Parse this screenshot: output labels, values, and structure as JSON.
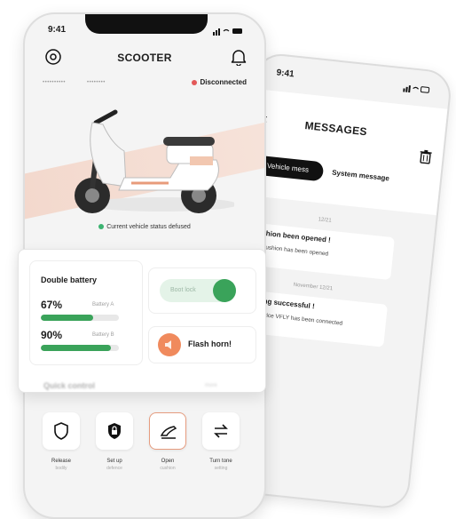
{
  "messages_phone": {
    "time": "9:41",
    "title": "MESSAGES",
    "tabs": [
      "Vehicle mess",
      "System message"
    ],
    "dates": [
      "12/21",
      "November 12/21"
    ],
    "messages": [
      {
        "title": "Cushion been opened !",
        "body": "The cushion has been opened"
      },
      {
        "title": "Binding successful !",
        "body": "Your device VFLY has been connected"
      }
    ]
  },
  "main_phone": {
    "time": "9:41",
    "title": "SCOOTER",
    "info": [
      "••••••••••",
      "••••••••"
    ],
    "connection_status": "Disconnected",
    "vehicle_status": "Current vehicle status defused",
    "battery": {
      "title": "Double battery",
      "items": [
        {
          "percent": "67%",
          "label": "Battery A",
          "level": 0.67
        },
        {
          "percent": "90%",
          "label": "Battery B",
          "level": 0.9
        }
      ]
    },
    "power_toggle": {
      "label": "Boot lock"
    },
    "flash_button": "Flash horn!",
    "section_label": "Quick control",
    "section_more": "more",
    "quick_controls": [
      {
        "icon": "shield-icon",
        "label": "Release",
        "sub": "bodily"
      },
      {
        "icon": "lock-icon",
        "label": "Set up",
        "sub": "defence"
      },
      {
        "icon": "seat-icon",
        "label": "Open",
        "sub": "cushion"
      },
      {
        "icon": "swap-icon",
        "label": "Turn tone",
        "sub": "setting"
      }
    ]
  },
  "colors": {
    "accent_green": "#3aa35a",
    "accent_orange": "#f08a5d",
    "status_red": "#e35959"
  }
}
